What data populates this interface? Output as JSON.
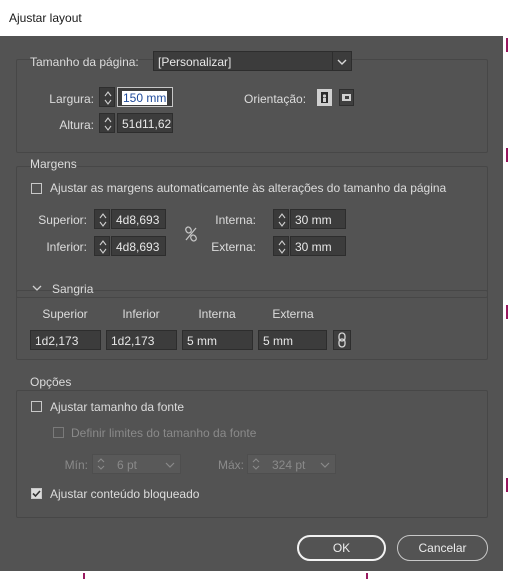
{
  "window": {
    "title": "Ajustar layout"
  },
  "page_size": {
    "label": "Tamanho da página:",
    "value": "[Personalizar]"
  },
  "dimensions": {
    "width_label": "Largura:",
    "width_value": "150 mm",
    "height_label": "Altura:",
    "height_value": "51d11,62",
    "orientation_label": "Orientação:"
  },
  "margins": {
    "title": "Margens",
    "auto_adjust_label": "Ajustar as margens automaticamente às alterações do tamanho da página",
    "auto_adjust_checked": false,
    "top_label": "Superior:",
    "top_value": "4d8,693",
    "bottom_label": "Inferior:",
    "bottom_value": "4d8,693",
    "inside_label": "Interna:",
    "inside_value": "30 mm",
    "outside_label": "Externa:",
    "outside_value": "30 mm"
  },
  "bleed": {
    "title": "Sangria",
    "top_label": "Superior",
    "top_value": "1d2,173",
    "bottom_label": "Inferior",
    "bottom_value": "1d2,173",
    "inside_label": "Interna",
    "inside_value": "5 mm",
    "outside_label": "Externa",
    "outside_value": "5 mm"
  },
  "options": {
    "title": "Opções",
    "font_size_label": "Ajustar tamanho da fonte",
    "font_size_checked": false,
    "limits_label": "Definir limites do tamanho da fonte",
    "limits_checked": false,
    "min_label": "Mín:",
    "min_value": "6 pt",
    "max_label": "Máx:",
    "max_value": "324 pt",
    "locked_label": "Ajustar conteúdo bloqueado",
    "locked_checked": true
  },
  "buttons": {
    "ok": "OK",
    "cancel": "Cancelar"
  },
  "icons": {
    "spinner": "spinner-arrows-icon",
    "portrait": "portrait-orientation-icon",
    "landscape": "landscape-orientation-icon",
    "link": "chain-link-icon",
    "chevron": "chevron-down-icon",
    "checkmark": "checkmark-icon"
  }
}
